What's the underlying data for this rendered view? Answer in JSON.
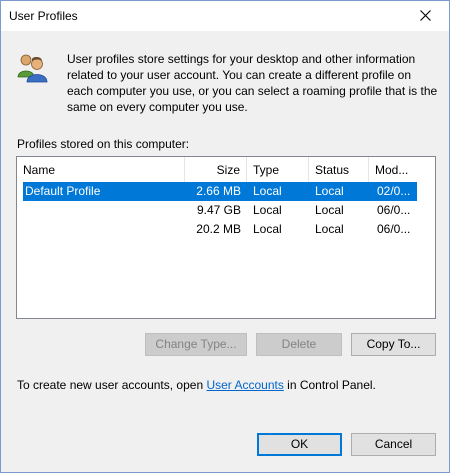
{
  "window": {
    "title": "User Profiles",
    "close_icon": "close-icon"
  },
  "intro_text": "User profiles store settings for your desktop and other information related to your user account. You can create a different profile on each computer you use, or you can select a roaming profile that is the same on every computer you use.",
  "list_label": "Profiles stored on this computer:",
  "columns": [
    "Name",
    "Size",
    "Type",
    "Status",
    "Mod..."
  ],
  "rows": [
    {
      "name": "Default Profile",
      "size": "2.66 MB",
      "type": "Local",
      "status": "Local",
      "modified": "02/0...",
      "selected": true
    },
    {
      "name": "",
      "size": "9.47 GB",
      "type": "Local",
      "status": "Local",
      "modified": "06/0...",
      "selected": false
    },
    {
      "name": "",
      "size": "20.2 MB",
      "type": "Local",
      "status": "Local",
      "modified": "06/0...",
      "selected": false
    }
  ],
  "buttons": {
    "change_type": "Change Type...",
    "delete": "Delete",
    "copy_to": "Copy To...",
    "ok": "OK",
    "cancel": "Cancel"
  },
  "footer": {
    "prefix": "To create new user accounts, open ",
    "link": "User Accounts",
    "suffix": " in Control Panel."
  },
  "colors": {
    "selection": "#0078d7",
    "link": "#0066cc",
    "accent_border": "#0078d7"
  }
}
